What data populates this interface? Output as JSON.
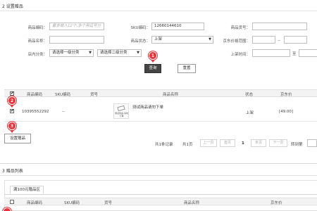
{
  "gift_setup": {
    "section_title": "2 设置赠品",
    "filters": {
      "product_code_label": "商品编码：",
      "product_code_placeholder": "最多输入12个,多个用逗号分",
      "sku_code_label": "SKU编码：",
      "sku_code_value": "12660144610",
      "product_no_label": "商品货号：",
      "product_name_label": "商品名称：",
      "product_status_label": "商品状态：",
      "product_status_value": "上架",
      "jd_price_label": "京东价格范围：",
      "price_sep": "_",
      "store_category_label": "店内分类：",
      "category_1_value": "请选择一级分类",
      "category_2_value": "请选择二级分类",
      "listing_time_label": "上架时间：",
      "time_sep": "至",
      "query_button": "查询",
      "reset_button": "重置"
    },
    "table": {
      "columns": [
        "商品编码",
        "SKU编码",
        "货号",
        "商品名称",
        "状态",
        "京东价"
      ],
      "rows": [
        {
          "checked": true,
          "product_code": "10395552292",
          "sku_code": "--",
          "product_no": "",
          "thumb_text": "测试商品,请勿下单",
          "name": "测试商品请勿下单",
          "status": "上架",
          "price": "[49.00]"
        }
      ]
    },
    "set_gift_button": "设置赠品",
    "pagination": {
      "total": "共1条记录",
      "pages": "共1页",
      "first": "上一页",
      "prev": "首页",
      "current": "1",
      "last": "末页",
      "next": "下一页",
      "jump_label": "转到第"
    }
  },
  "gift_list": {
    "section_title": "3 赠品列表",
    "tab_label": "满100元赠品区",
    "columns": [
      "商品编码",
      "SKU编码",
      "货号",
      "商品名称",
      "京东价"
    ]
  },
  "markers": [
    "1",
    "2",
    "3"
  ],
  "colors": {
    "marker": "#e8333a",
    "query_button": "#444444"
  }
}
